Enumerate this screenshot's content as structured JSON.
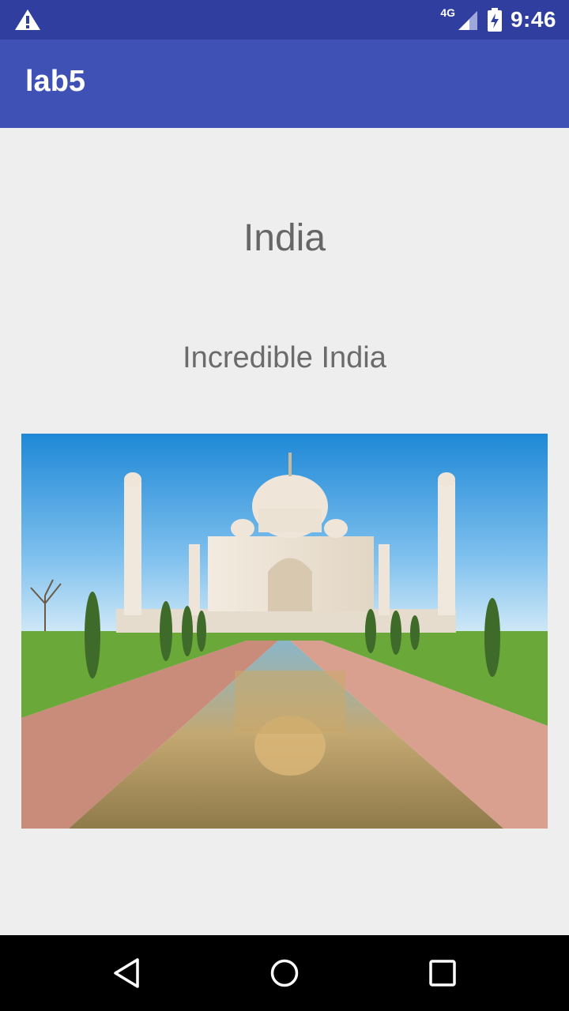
{
  "status_bar": {
    "network": "4G",
    "time": "9:46"
  },
  "app_bar": {
    "title": "lab5"
  },
  "main": {
    "heading": "India",
    "subheading": "Incredible India",
    "image_icon": "taj-mahal-photo"
  },
  "nav_bar": {
    "icons": [
      "back-icon",
      "home-icon",
      "recents-icon"
    ]
  },
  "colors": {
    "status_bar": "#303f9f",
    "app_bar": "#3f51b5",
    "background": "#eeeeee",
    "text": "#666666"
  }
}
